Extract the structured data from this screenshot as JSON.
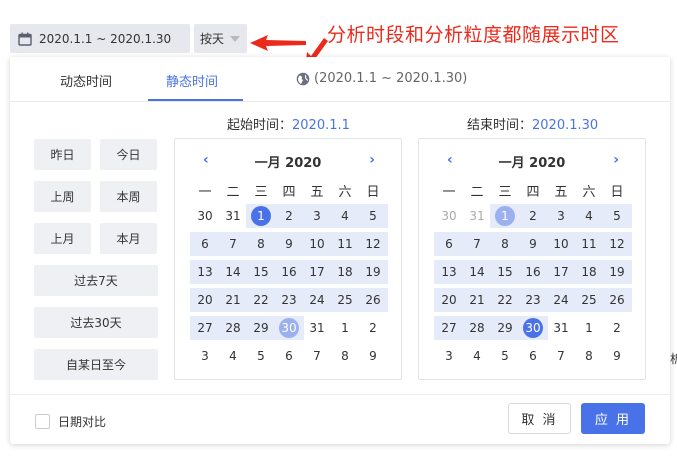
{
  "top": {
    "range_text": "2020.1.1 ~ 2020.1.30",
    "granularity": "按天",
    "annotation": "分析时段和分析粒度都随展示时区"
  },
  "tabs": {
    "dynamic": "动态时间",
    "static": "静态时间",
    "range_display": "(2020.1.1 ~ 2020.1.30)"
  },
  "labels": {
    "start_prefix": "起始时间：",
    "start_value": "2020.1.1",
    "end_prefix": "结束时间：",
    "end_value": "2020.1.30"
  },
  "quick": {
    "yesterday": "昨日",
    "today": "今日",
    "last_week": "上周",
    "this_week": "本周",
    "last_month": "上月",
    "this_month": "本月",
    "past_7": "过去7天",
    "past_30": "过去30天",
    "since_day": "自某日至今"
  },
  "calendar": {
    "month_title": "一月 2020",
    "prev": "‹",
    "next": "›",
    "weekdays": [
      "一",
      "二",
      "三",
      "四",
      "五",
      "六",
      "日"
    ]
  },
  "footer": {
    "compare_label": "日期对比",
    "cancel": "取 消",
    "apply": "应 用"
  },
  "edge_char": "析",
  "colors": {
    "accent": "#4a72e8",
    "range_bg": "#e6ebf9",
    "annotation": "#ec2a1c"
  }
}
